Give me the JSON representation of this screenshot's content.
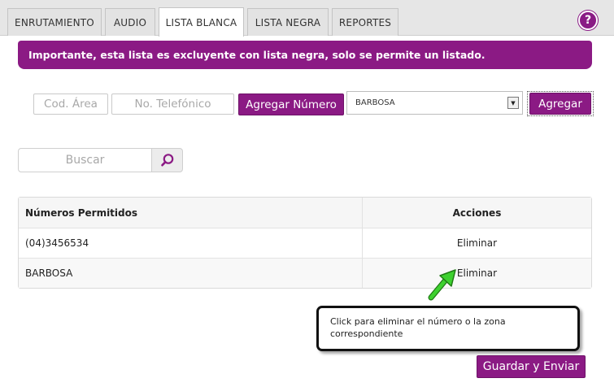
{
  "tabs": [
    {
      "label": "ENRUTAMIENTO",
      "active": false
    },
    {
      "label": "AUDIO",
      "active": false
    },
    {
      "label": "LISTA BLANCA",
      "active": true
    },
    {
      "label": "LISTA NEGRA",
      "active": false
    },
    {
      "label": "REPORTES",
      "active": false
    }
  ],
  "help": {
    "label": "?"
  },
  "banner": {
    "text": "Importante, esta lista es excluyente con lista negra, solo se permite un listado."
  },
  "form": {
    "area_placeholder": "Cod. Área",
    "phone_placeholder": "No. Telefónico",
    "add_number_label": "Agregar Número",
    "zone_selected": "BARBOSA",
    "add_label": "Agregar"
  },
  "search": {
    "placeholder": "Buscar",
    "icon": "search-icon"
  },
  "table": {
    "headers": [
      "Números Permitidos",
      "Acciones"
    ],
    "rows": [
      {
        "value": "(04)3456534",
        "action": "Eliminar"
      },
      {
        "value": "BARBOSA",
        "action": "Eliminar"
      }
    ]
  },
  "callout": {
    "text": "Click para eliminar el número o la zona correspondiente"
  },
  "save_label": "Guardar y Enviar",
  "colors": {
    "accent": "#8b1a84",
    "arrow": "#3dd12f"
  }
}
